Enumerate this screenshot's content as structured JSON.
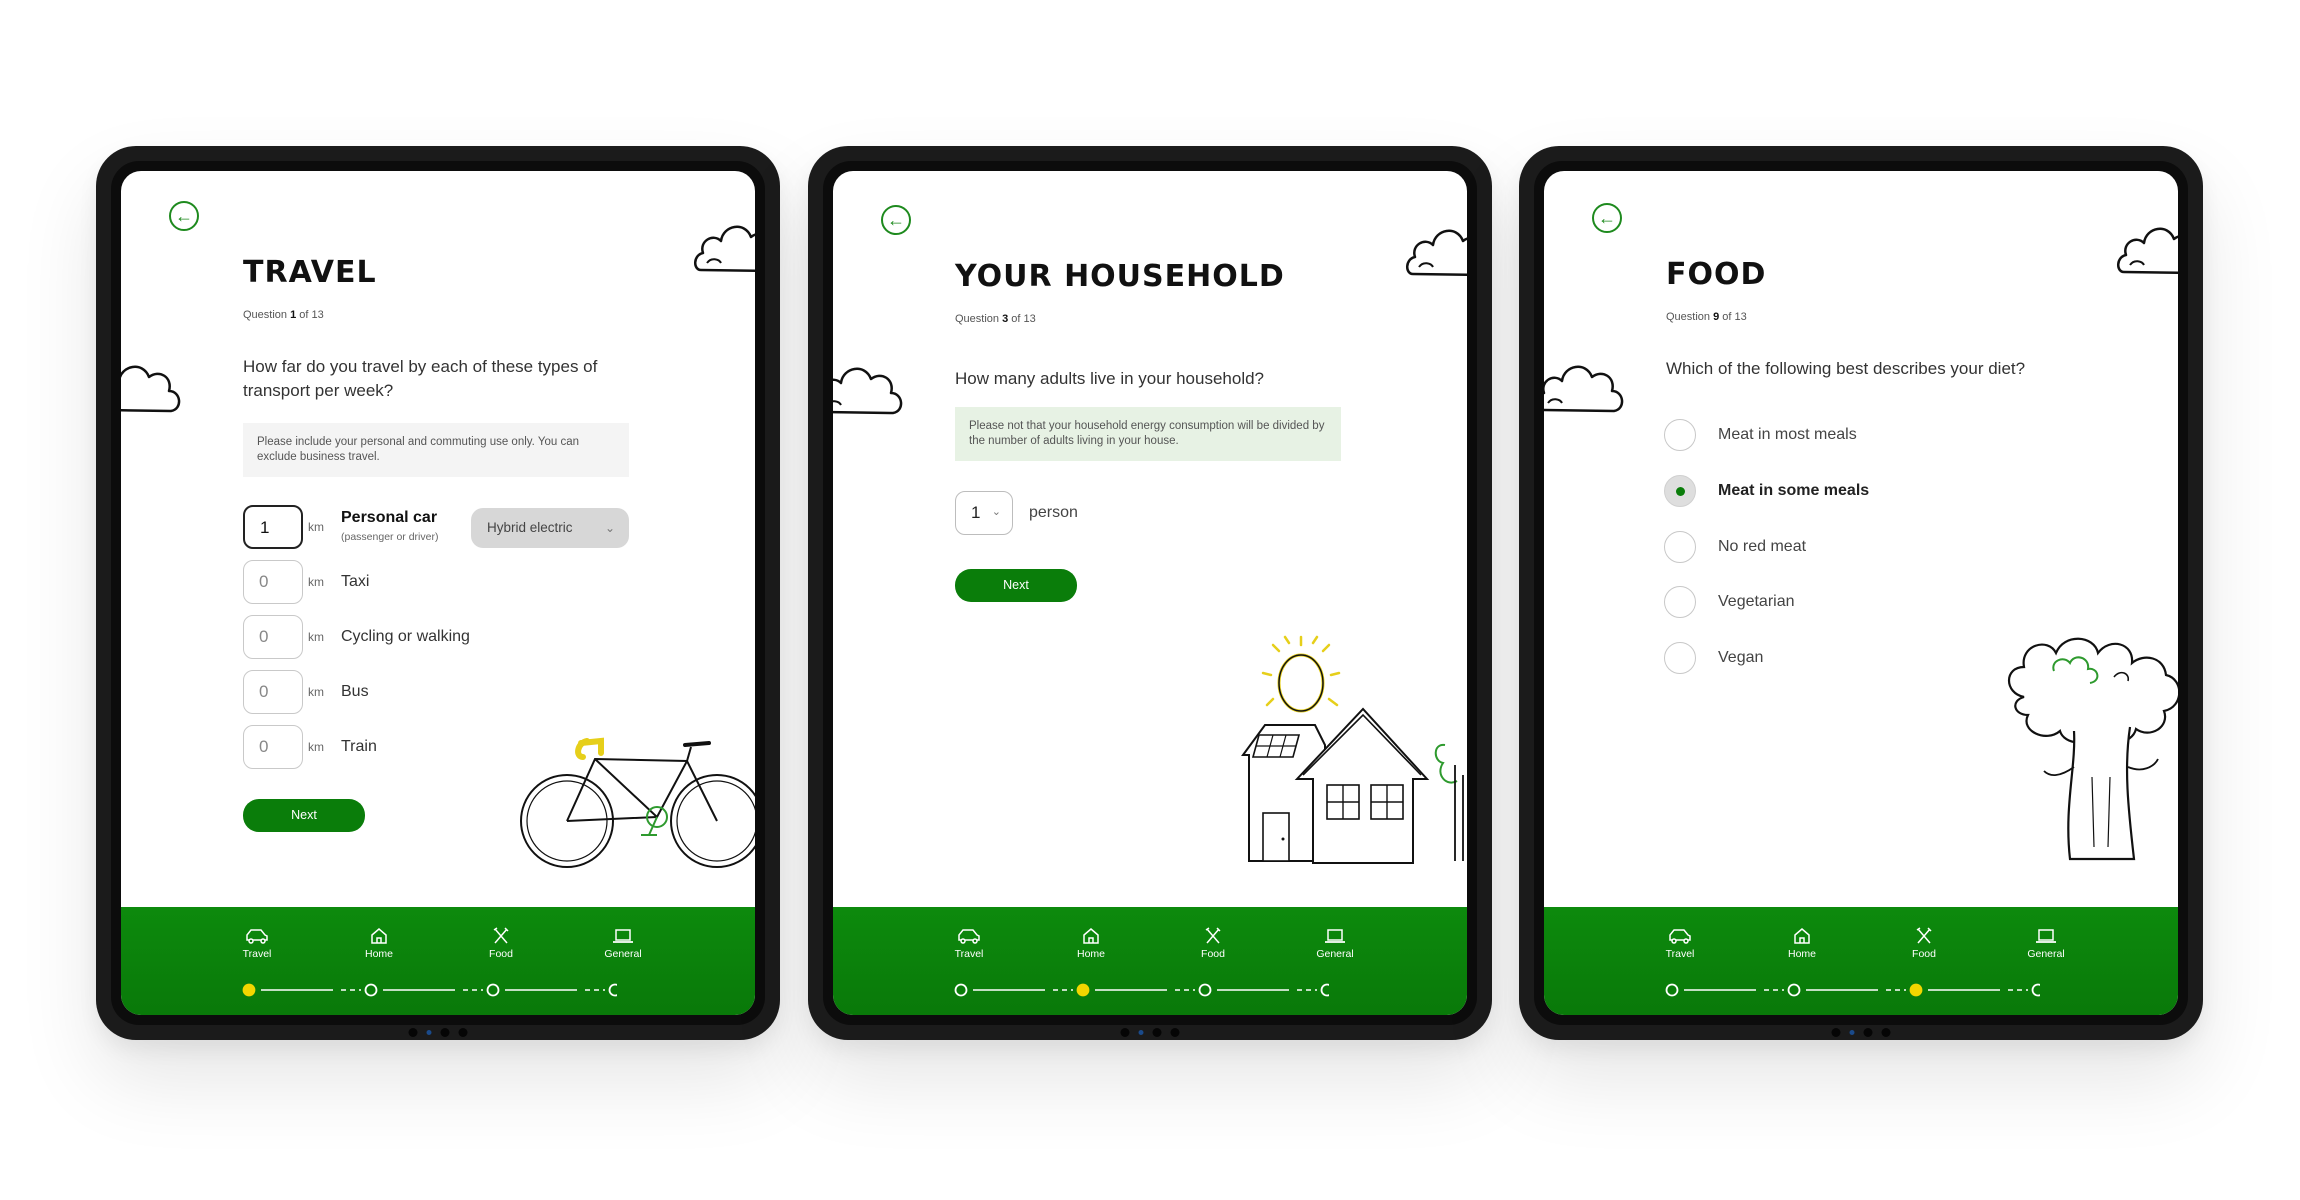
{
  "colors": {
    "accent": "#0a7d0a",
    "progress_active": "#f2d600"
  },
  "nav": {
    "items": [
      {
        "label": "Travel",
        "icon": "car-icon"
      },
      {
        "label": "Home",
        "icon": "house-icon"
      },
      {
        "label": "Food",
        "icon": "cutlery-icon"
      },
      {
        "label": "General",
        "icon": "laptop-icon"
      }
    ]
  },
  "travel": {
    "title": "TRAVEL",
    "question_prefix": "Question",
    "question_num": "1",
    "question_suffix": "of 13",
    "question": "How far do you travel by each of these types of transport per week?",
    "note": "Please include your personal and commuting use only. You can exclude business travel.",
    "unit": "km",
    "rows": [
      {
        "value": "1",
        "label": "Personal car",
        "sublabel": "(passenger or driver)"
      },
      {
        "value": "0",
        "label": "Taxi"
      },
      {
        "value": "0",
        "label": "Cycling or walking"
      },
      {
        "value": "0",
        "label": "Bus"
      },
      {
        "value": "0",
        "label": "Train"
      }
    ],
    "car_type": "Hybrid electric",
    "next_label": "Next",
    "active_step": 0
  },
  "household": {
    "title": "YOUR HOUSEHOLD",
    "question_prefix": "Question",
    "question_num": "3",
    "question_suffix": "of 13",
    "question": "How many adults live in your household?",
    "note": "Please not that your household energy consumption will be divided by the number of adults living in your house.",
    "adults_value": "1",
    "unit_label": "person",
    "next_label": "Next",
    "active_step": 1
  },
  "food": {
    "title": "FOOD",
    "question_prefix": "Question",
    "question_num": "9",
    "question_suffix": "of 13",
    "question": "Which of the following best describes your diet?",
    "options": [
      {
        "label": "Meat in most meals",
        "selected": false
      },
      {
        "label": "Meat in some meals",
        "selected": true
      },
      {
        "label": "No red meat",
        "selected": false
      },
      {
        "label": "Vegetarian",
        "selected": false
      },
      {
        "label": "Vegan",
        "selected": false
      }
    ],
    "active_step": 2
  }
}
